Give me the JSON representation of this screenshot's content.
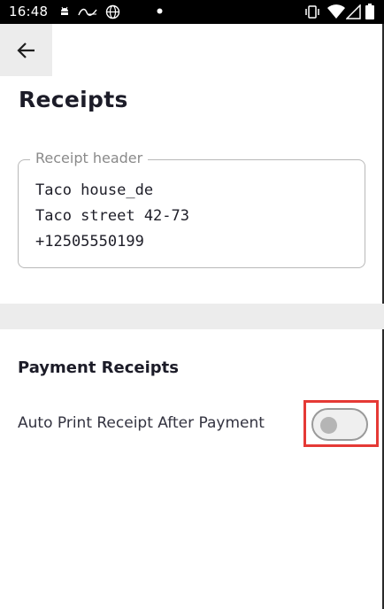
{
  "status_bar": {
    "time": "16:48",
    "left_icons": [
      "android-icon",
      "wallet-icon",
      "globe-icon",
      "dot-icon"
    ],
    "right_icons": [
      "vibrate-icon",
      "wifi-icon",
      "signal-icon",
      "battery-icon"
    ]
  },
  "header": {
    "back_icon": "arrow-left-icon",
    "title": "Receipts"
  },
  "receipt_header": {
    "label": "Receipt header",
    "value": "Taco house_de\nTaco street 42-73\n+12505550199"
  },
  "payment_receipts": {
    "title": "Payment Receipts",
    "auto_print": {
      "label": "Auto Print Receipt After Payment",
      "enabled": false
    }
  },
  "colors": {
    "highlight": "#e53935",
    "band": "#ececec",
    "toggle_off_knob": "#b5b5b5"
  }
}
